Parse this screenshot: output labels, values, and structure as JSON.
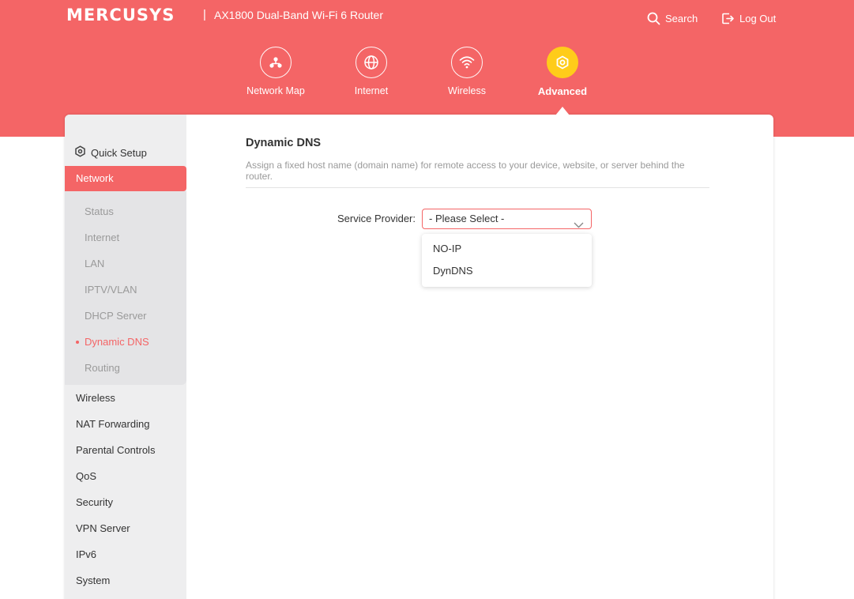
{
  "brand": {
    "logo_text": "MERCUSYS",
    "separator": "|",
    "router_title": "AX1800 Dual-Band Wi-Fi 6 Router"
  },
  "header_actions": {
    "search_label": "Search",
    "logout_label": "Log Out"
  },
  "top_nav": [
    {
      "label": "Network Map",
      "icon": "network-map-icon"
    },
    {
      "label": "Internet",
      "icon": "globe-icon"
    },
    {
      "label": "Wireless",
      "icon": "wifi-icon"
    },
    {
      "label": "Advanced",
      "icon": "gear-icon",
      "active": true
    }
  ],
  "sidebar": {
    "quick_setup": "Quick Setup",
    "network": "Network",
    "network_items": [
      "Status",
      "Internet",
      "LAN",
      "IPTV/VLAN",
      "DHCP Server",
      "Dynamic DNS",
      "Routing"
    ],
    "active_item": "Dynamic DNS",
    "main_items": [
      "Wireless",
      "NAT Forwarding",
      "Parental Controls",
      "QoS",
      "Security",
      "VPN Server",
      "IPv6",
      "System"
    ]
  },
  "page": {
    "title": "Dynamic DNS",
    "description": "Assign a fixed host name (domain name) for remote access to your device, website, or server behind the router.",
    "service_provider_label": "Service Provider:",
    "select_value": "- Please Select -",
    "dropdown_options": [
      "NO-IP",
      "DynDNS"
    ]
  },
  "colors": {
    "accent": "#f46566",
    "active_nav": "#ffcc1a",
    "sidebar_bg": "#eeeeef",
    "subpanel_bg": "#e4e4e6"
  }
}
